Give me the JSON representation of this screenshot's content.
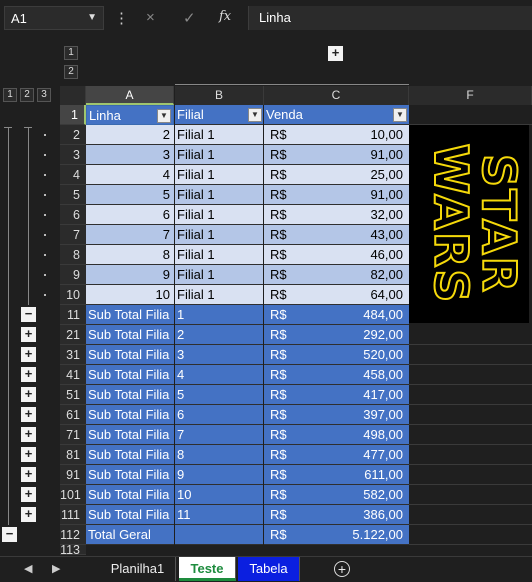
{
  "formula_bar": {
    "name_box": "A1",
    "formula": "Linha",
    "cancel_icon": "×",
    "enter_icon": "✓",
    "fx_label": "fx"
  },
  "outline": {
    "col_levels": [
      "1",
      "2"
    ],
    "row_levels": [
      "1",
      "2",
      "3"
    ],
    "col_expand": "+"
  },
  "columns": [
    "A",
    "B",
    "C",
    "F"
  ],
  "header_row": {
    "row": "1",
    "a": "Linha",
    "b": "Filial",
    "c": "Venda"
  },
  "rows": [
    {
      "row": "2",
      "a": "2",
      "b": "Filial 1",
      "cur": "R$",
      "val": "10,00",
      "style": "light"
    },
    {
      "row": "3",
      "a": "3",
      "b": "Filial 1",
      "cur": "R$",
      "val": "91,00",
      "style": "mid"
    },
    {
      "row": "4",
      "a": "4",
      "b": "Filial 1",
      "cur": "R$",
      "val": "25,00",
      "style": "light"
    },
    {
      "row": "5",
      "a": "5",
      "b": "Filial 1",
      "cur": "R$",
      "val": "91,00",
      "style": "mid"
    },
    {
      "row": "6",
      "a": "6",
      "b": "Filial 1",
      "cur": "R$",
      "val": "32,00",
      "style": "light"
    },
    {
      "row": "7",
      "a": "7",
      "b": "Filial 1",
      "cur": "R$",
      "val": "43,00",
      "style": "mid"
    },
    {
      "row": "8",
      "a": "8",
      "b": "Filial 1",
      "cur": "R$",
      "val": "46,00",
      "style": "light"
    },
    {
      "row": "9",
      "a": "9",
      "b": "Filial 1",
      "cur": "R$",
      "val": "82,00",
      "style": "mid"
    },
    {
      "row": "10",
      "a": "10",
      "b": "Filial 1",
      "cur": "R$",
      "val": "64,00",
      "style": "light"
    }
  ],
  "subtotals": [
    {
      "row": "11",
      "a": "Sub Total Filia",
      "b": "1",
      "cur": "R$",
      "val": "484,00",
      "btn": "−"
    },
    {
      "row": "21",
      "a": "Sub Total Filia",
      "b": "2",
      "cur": "R$",
      "val": "292,00",
      "btn": "+"
    },
    {
      "row": "31",
      "a": "Sub Total Filia",
      "b": "3",
      "cur": "R$",
      "val": "520,00",
      "btn": "+"
    },
    {
      "row": "41",
      "a": "Sub Total Filia",
      "b": "4",
      "cur": "R$",
      "val": "458,00",
      "btn": "+"
    },
    {
      "row": "51",
      "a": "Sub Total Filia",
      "b": "5",
      "cur": "R$",
      "val": "417,00",
      "btn": "+"
    },
    {
      "row": "61",
      "a": "Sub Total Filia",
      "b": "6",
      "cur": "R$",
      "val": "397,00",
      "btn": "+"
    },
    {
      "row": "71",
      "a": "Sub Total Filia",
      "b": "7",
      "cur": "R$",
      "val": "498,00",
      "btn": "+"
    },
    {
      "row": "81",
      "a": "Sub Total Filia",
      "b": "8",
      "cur": "R$",
      "val": "477,00",
      "btn": "+"
    },
    {
      "row": "91",
      "a": "Sub Total Filia",
      "b": "9",
      "cur": "R$",
      "val": "611,00",
      "btn": "+"
    },
    {
      "row": "101",
      "a": "Sub Total Filia",
      "b": "10",
      "cur": "R$",
      "val": "582,00",
      "btn": "+"
    },
    {
      "row": "111",
      "a": "Sub Total Filia",
      "b": "11",
      "cur": "R$",
      "val": "386,00",
      "btn": "+"
    }
  ],
  "grand_total": {
    "row": "112",
    "a": "Total Geral",
    "b": "",
    "cur": "R$",
    "val": "5.122,00",
    "btn": "−"
  },
  "partial_row": "113",
  "image": {
    "line1": "STAR",
    "line2": "WARS",
    "color": "#f5d90a"
  },
  "sheets": [
    "Planilha1",
    "Teste",
    "Tabela"
  ],
  "active_sheet": "Teste",
  "colors": {
    "header_blue": "#4472c4",
    "band_light": "#d9e1f2",
    "band_mid": "#b4c6e7",
    "tab_blue": "#0b1fe0",
    "active_green": "#1e8c3e"
  }
}
